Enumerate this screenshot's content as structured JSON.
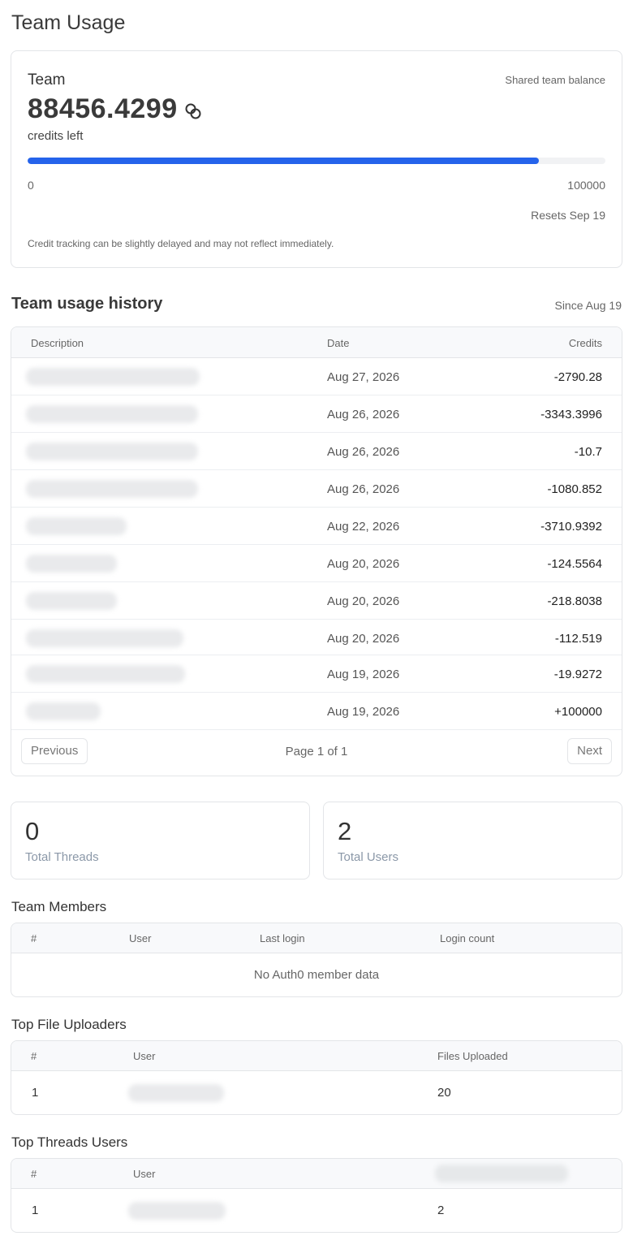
{
  "page": {
    "title": "Team Usage"
  },
  "balance": {
    "team_label": "Team",
    "shared_label": "Shared team balance",
    "credits_value": "88456.4299",
    "credits_unit": "credits left",
    "min_label": "0",
    "max_label": "100000",
    "progress_percent": 88.46,
    "resets": "Resets Sep 19",
    "note": "Credit tracking can be slightly delayed and may not reflect immediately.",
    "accent_color": "#2563eb",
    "icon": "coins-icon"
  },
  "history": {
    "title": "Team usage history",
    "since": "Since Aug 19",
    "columns": {
      "description": "Description",
      "date": "Date",
      "credits": "Credits"
    },
    "rows": [
      {
        "date": "Aug 27, 2026",
        "credits": "-2790.28"
      },
      {
        "date": "Aug 26, 2026",
        "credits": "-3343.3996"
      },
      {
        "date": "Aug 26, 2026",
        "credits": "-10.7"
      },
      {
        "date": "Aug 26, 2026",
        "credits": "-1080.852"
      },
      {
        "date": "Aug 22, 2026",
        "credits": "-3710.9392"
      },
      {
        "date": "Aug 20, 2026",
        "credits": "-124.5564"
      },
      {
        "date": "Aug 20, 2026",
        "credits": "-218.8038"
      },
      {
        "date": "Aug 20, 2026",
        "credits": "-112.519"
      },
      {
        "date": "Aug 19, 2026",
        "credits": "-19.9272"
      },
      {
        "date": "Aug 19, 2026",
        "credits": "+100000"
      }
    ],
    "pager": {
      "previous": "Previous",
      "page_info": "Page 1 of 1",
      "next": "Next"
    }
  },
  "stats": {
    "threads": {
      "value": "0",
      "label": "Total Threads"
    },
    "users": {
      "value": "2",
      "label": "Total Users"
    }
  },
  "members": {
    "title": "Team Members",
    "columns": {
      "num": "#",
      "user": "User",
      "last_login": "Last login",
      "login_count": "Login count"
    },
    "empty": "No Auth0 member data"
  },
  "uploaders": {
    "title": "Top File Uploaders",
    "columns": {
      "num": "#",
      "user": "User",
      "files": "Files Uploaded"
    },
    "rows": [
      {
        "num": "1",
        "files": "20"
      }
    ]
  },
  "threads_users": {
    "title": "Top Threads Users",
    "columns": {
      "num": "#",
      "user": "User"
    },
    "rows": [
      {
        "num": "1",
        "count": "2"
      }
    ]
  }
}
